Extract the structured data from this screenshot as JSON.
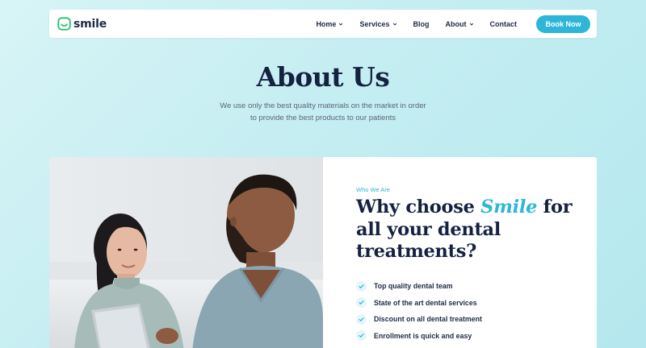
{
  "brand": {
    "name": "smile",
    "icon": "smile-logo-icon",
    "accent_color": "#2eb6d9"
  },
  "nav": {
    "items": [
      {
        "label": "Home",
        "dropdown": true
      },
      {
        "label": "Services",
        "dropdown": true
      },
      {
        "label": "Blog",
        "dropdown": false
      },
      {
        "label": "About",
        "dropdown": true
      },
      {
        "label": "Contact",
        "dropdown": false
      }
    ],
    "cta": "Book Now"
  },
  "hero": {
    "title": "About Us",
    "subtitle_line1": "We use only the best quality materials on the market in order",
    "subtitle_line2": "to provide the best products to our patients"
  },
  "about": {
    "eyebrow": "Who We Are",
    "title_part1": "Why choose ",
    "title_accent": "Smile",
    "title_part2": " for all your dental treatments?",
    "features": [
      "Top quality dental team",
      "State of the art dental services",
      "Discount on all dental treatment",
      "Enrollment is quick and easy"
    ],
    "photo": "dentist-consultation-photo"
  }
}
